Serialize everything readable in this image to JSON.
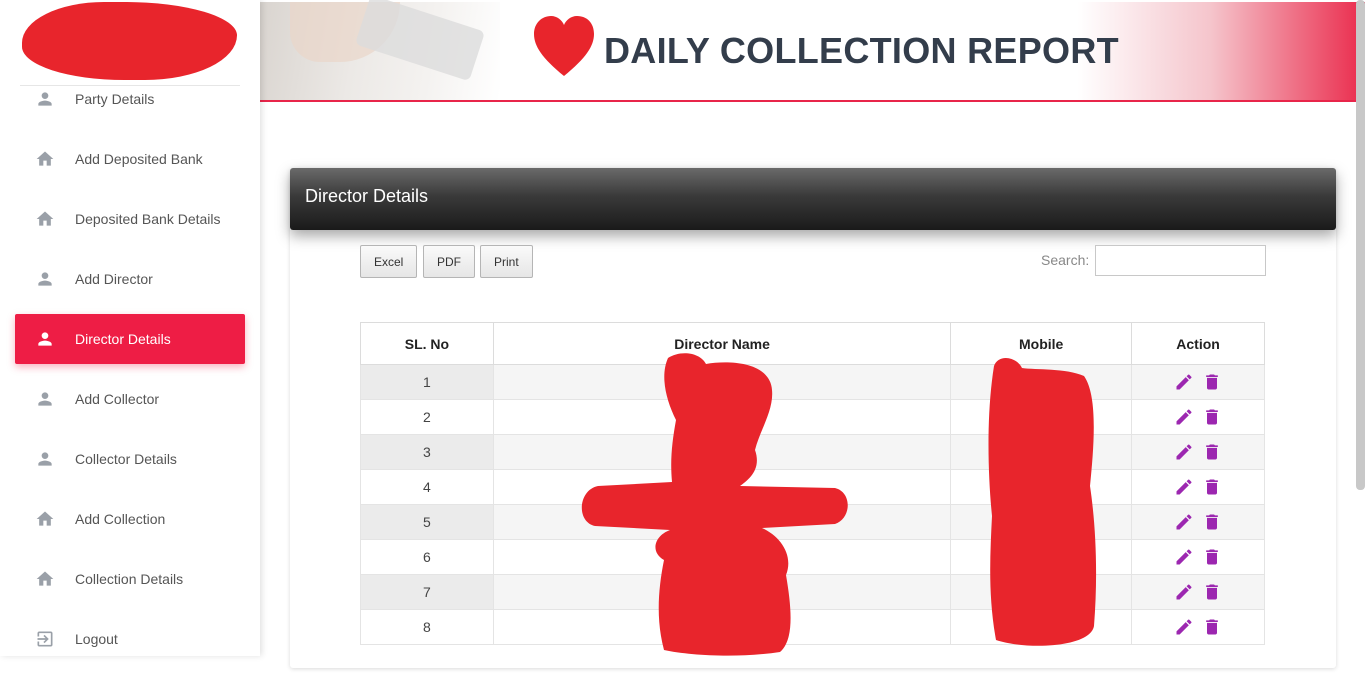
{
  "header": {
    "title": "DAILY COLLECTION REPORT"
  },
  "sidebar": {
    "items": [
      {
        "label": "Party Details",
        "icon": "person-icon",
        "active": false
      },
      {
        "label": "Add Deposited Bank",
        "icon": "home-icon",
        "active": false
      },
      {
        "label": "Deposited Bank Details",
        "icon": "home-icon",
        "active": false
      },
      {
        "label": "Add Director",
        "icon": "person-icon",
        "active": false
      },
      {
        "label": "Director Details",
        "icon": "person-icon",
        "active": true
      },
      {
        "label": "Add Collector",
        "icon": "person-icon",
        "active": false
      },
      {
        "label": "Collector Details",
        "icon": "person-icon",
        "active": false
      },
      {
        "label": "Add Collection",
        "icon": "home-icon",
        "active": false
      },
      {
        "label": "Collection Details",
        "icon": "home-icon",
        "active": false
      },
      {
        "label": "Logout",
        "icon": "logout-icon",
        "active": false
      }
    ]
  },
  "card": {
    "title": "Director Details",
    "buttons": {
      "excel": "Excel",
      "pdf": "PDF",
      "print": "Print"
    },
    "search": {
      "label": "Search:",
      "value": ""
    },
    "table": {
      "headers": [
        "SL. No",
        "Director Name",
        "Mobile",
        "Action"
      ],
      "rows": [
        "1",
        "2",
        "3",
        "4",
        "5",
        "6",
        "7",
        "8"
      ]
    }
  },
  "colors": {
    "accent": "#ee1d45",
    "action_icon": "#9c27b0",
    "title_text": "#333d4b"
  }
}
